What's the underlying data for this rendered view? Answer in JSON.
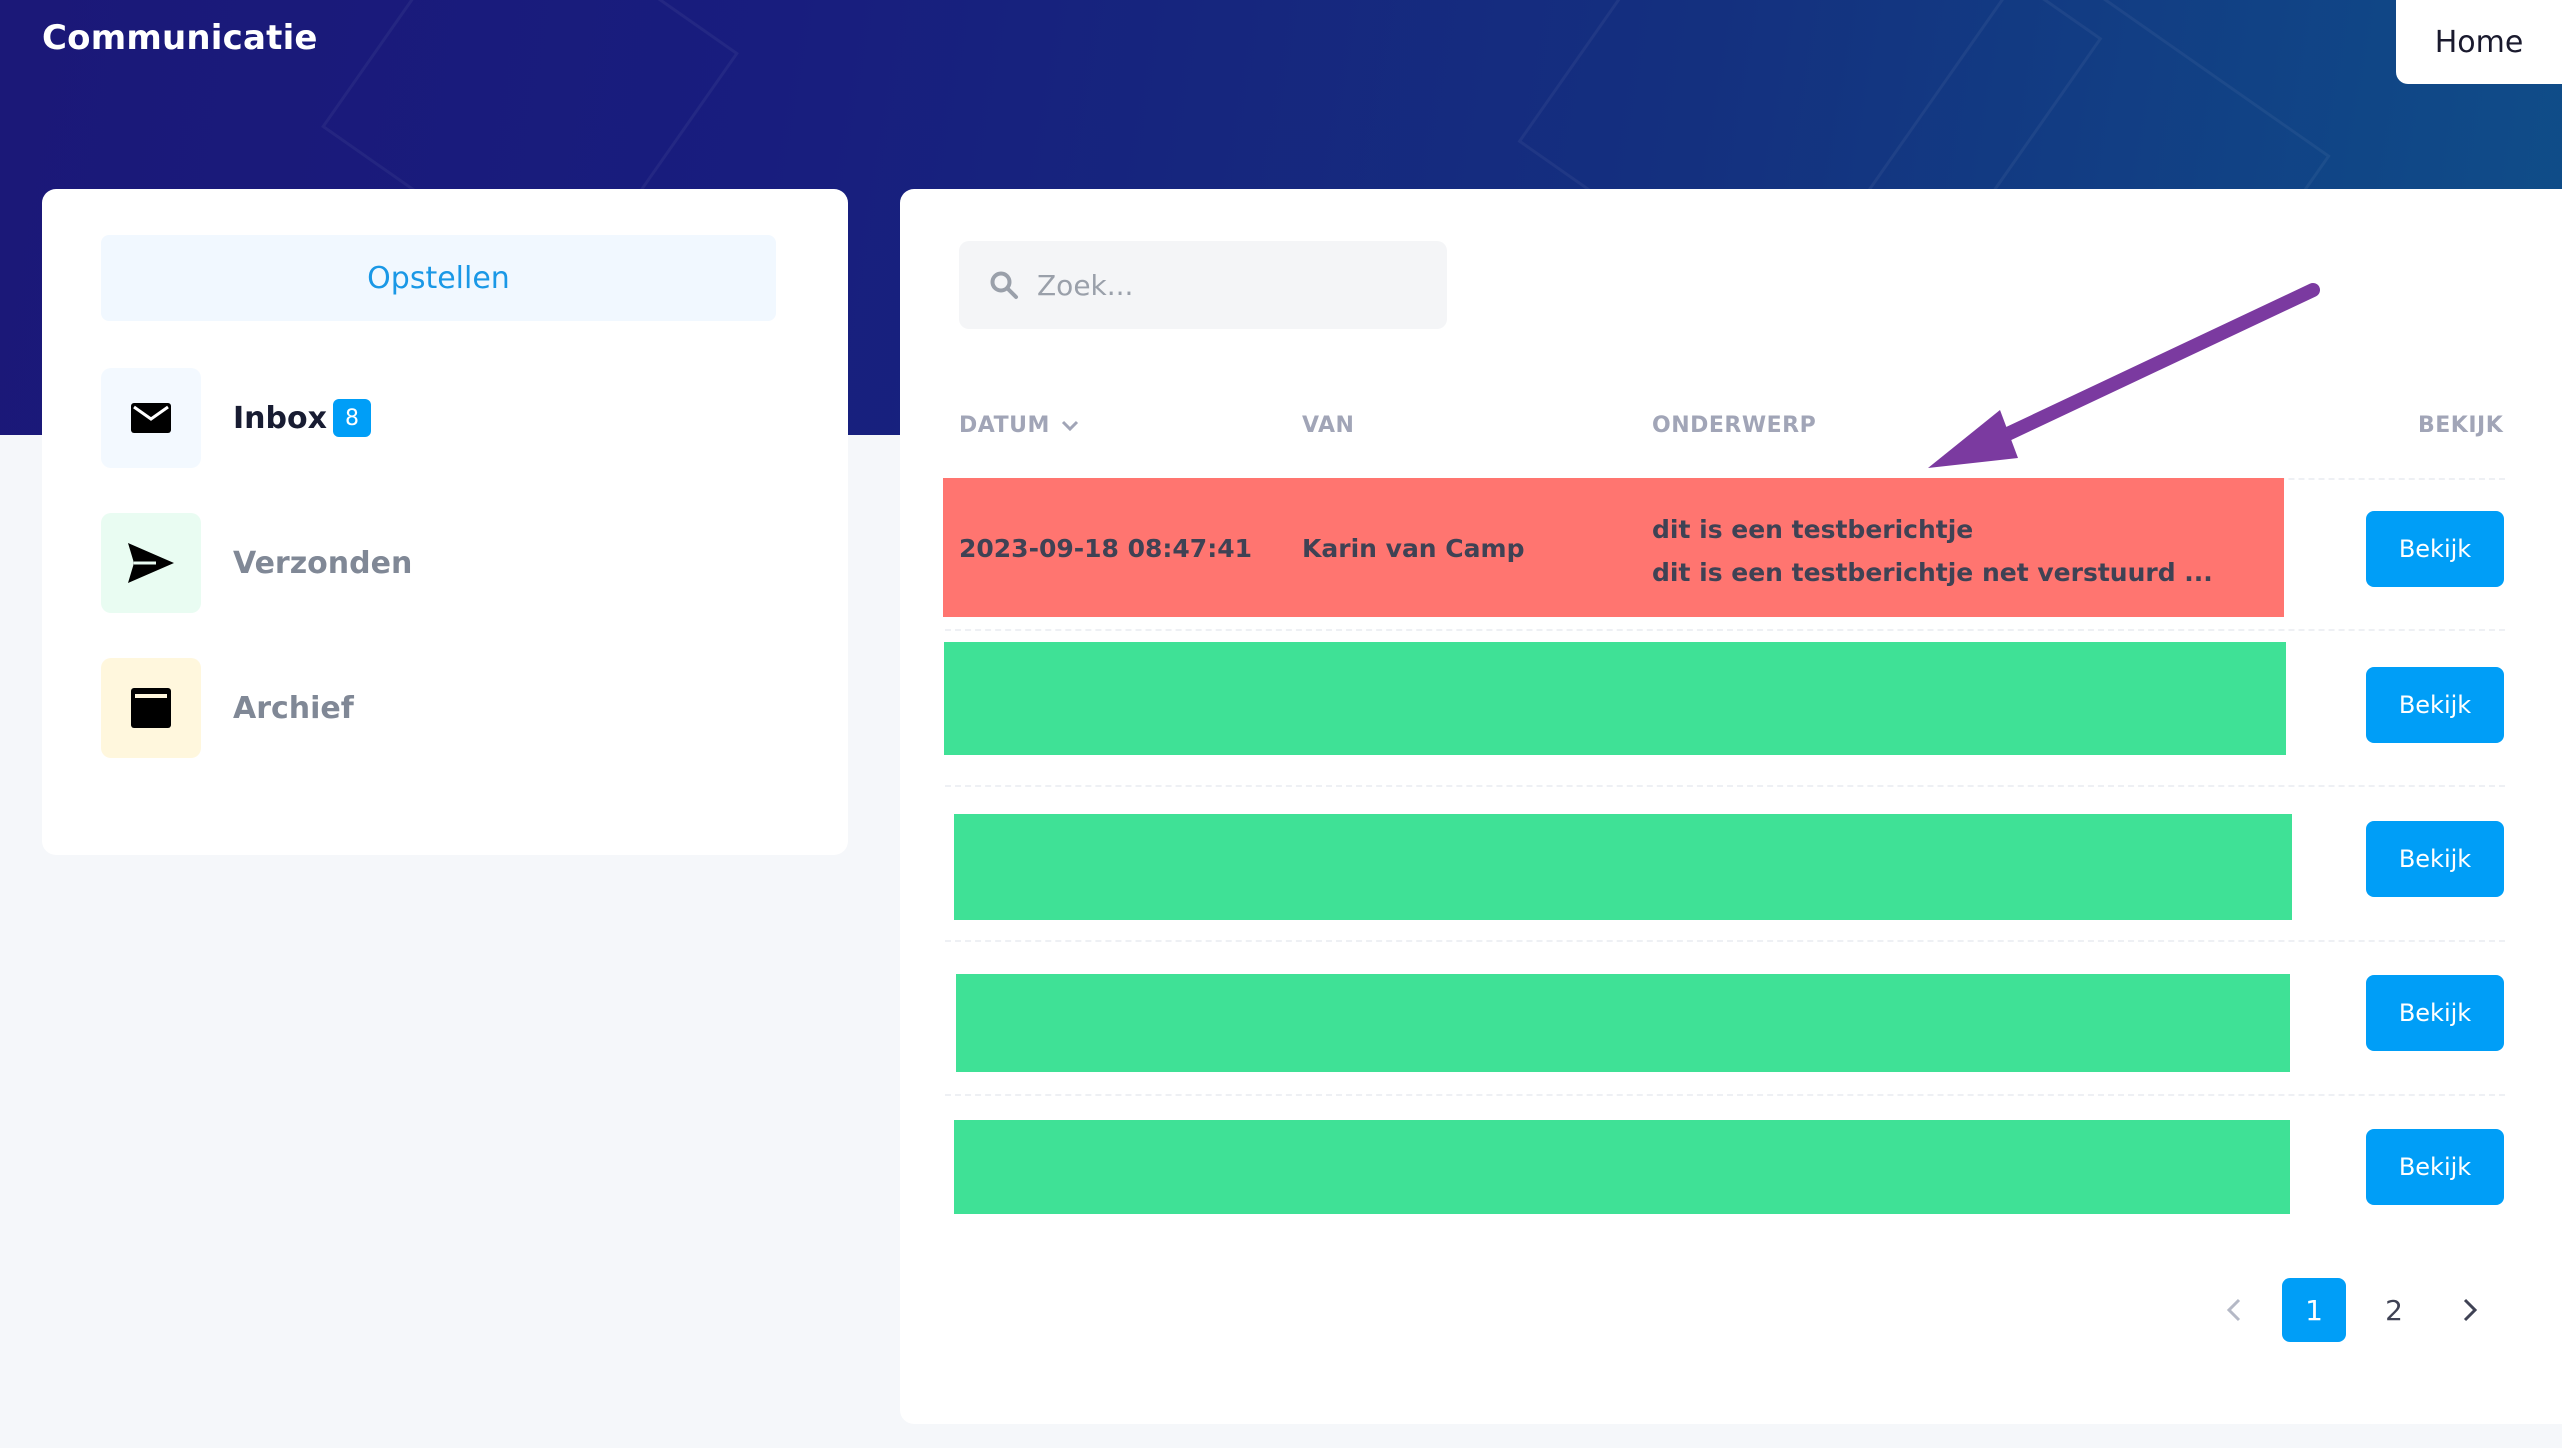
{
  "header": {
    "title": "Communicatie",
    "home_label": "Home"
  },
  "sidebar": {
    "compose_label": "Opstellen",
    "items": [
      {
        "label": "Inbox",
        "badge": "8",
        "icon": "envelope-icon",
        "active": true,
        "icon_bg": "#f3f9ff"
      },
      {
        "label": "Verzonden",
        "icon": "send-icon",
        "active": false,
        "icon_bg": "#e9fcf2"
      },
      {
        "label": "Archief",
        "icon": "archive-icon",
        "active": false,
        "icon_bg": "#fff7dd"
      }
    ]
  },
  "search": {
    "placeholder": "Zoek..."
  },
  "table": {
    "columns": {
      "date": "DATUM",
      "from": "VAN",
      "subject": "ONDERWERP",
      "view": "BEKIJK"
    },
    "rows": [
      {
        "date": "2023-09-18 08:47:41",
        "from": "Karin van Camp",
        "subject": "dit is een testberichtje",
        "preview": "dit is een testberichtje net verstuurd ...",
        "redacted": false,
        "highlight": "#ff7570"
      },
      {
        "redacted": true,
        "highlight": "#3fe196"
      },
      {
        "redacted": true,
        "highlight": "#3fe196"
      },
      {
        "redacted": true,
        "highlight": "#3fe196"
      },
      {
        "redacted": true,
        "highlight": "#3fe196"
      }
    ],
    "view_label": "Bekijk"
  },
  "pagination": {
    "pages": [
      "1",
      "2"
    ],
    "current": "1"
  },
  "colors": {
    "accent": "#009ef7",
    "annotation_arrow": "#7b3aa0"
  }
}
